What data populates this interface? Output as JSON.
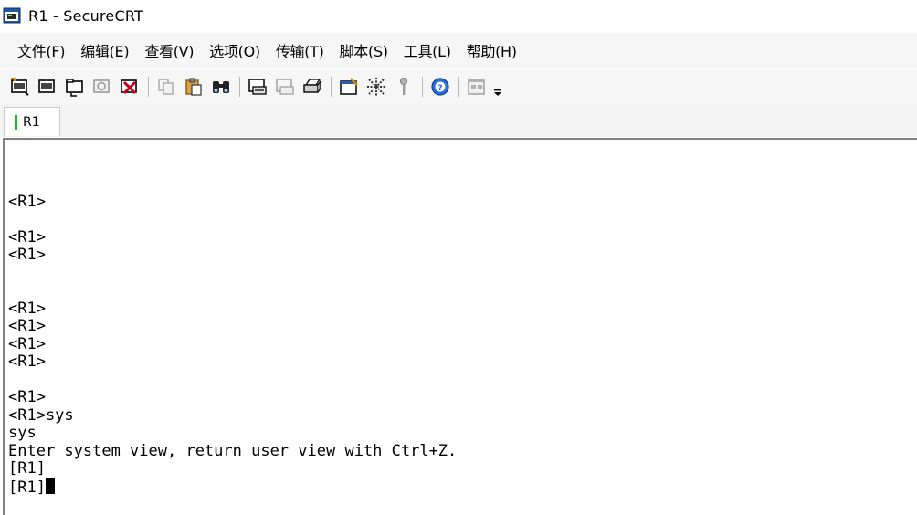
{
  "window": {
    "title": "R1 - SecureCRT"
  },
  "menu": {
    "items": [
      "文件(F)",
      "编辑(E)",
      "查看(V)",
      "选项(O)",
      "传输(T)",
      "脚本(S)",
      "工具(L)",
      "帮助(H)"
    ]
  },
  "toolbar": {
    "icons": [
      "connect-icon",
      "quick-connect-icon",
      "connect-tab-icon",
      "reconnect-icon",
      "disconnect-icon",
      "copy-icon",
      "paste-icon",
      "find-icon",
      "print-setup-icon",
      "print-selection-icon",
      "print-icon",
      "session-options-icon",
      "global-options-icon",
      "keymap-icon",
      "help-icon",
      "tile-icon",
      "toolbar-dropdown-icon"
    ]
  },
  "tabs": [
    {
      "label": "R1",
      "status_color": "#10c020"
    }
  ],
  "terminal": {
    "lines": [
      "",
      "<R1>",
      "",
      "<R1>",
      "<R1>",
      "",
      "",
      "<R1>",
      "<R1>",
      "<R1>",
      "<R1>",
      "",
      "<R1>",
      "<R1>sys",
      "sys",
      "Enter system view, return user view with Ctrl+Z.",
      "[R1]",
      "[R1]"
    ],
    "cursor_after_last_line": true
  },
  "colors": {
    "menubar_bg": "#f6f6f6",
    "terminal_bg": "#ffffff",
    "tab_status": "#10c020"
  }
}
